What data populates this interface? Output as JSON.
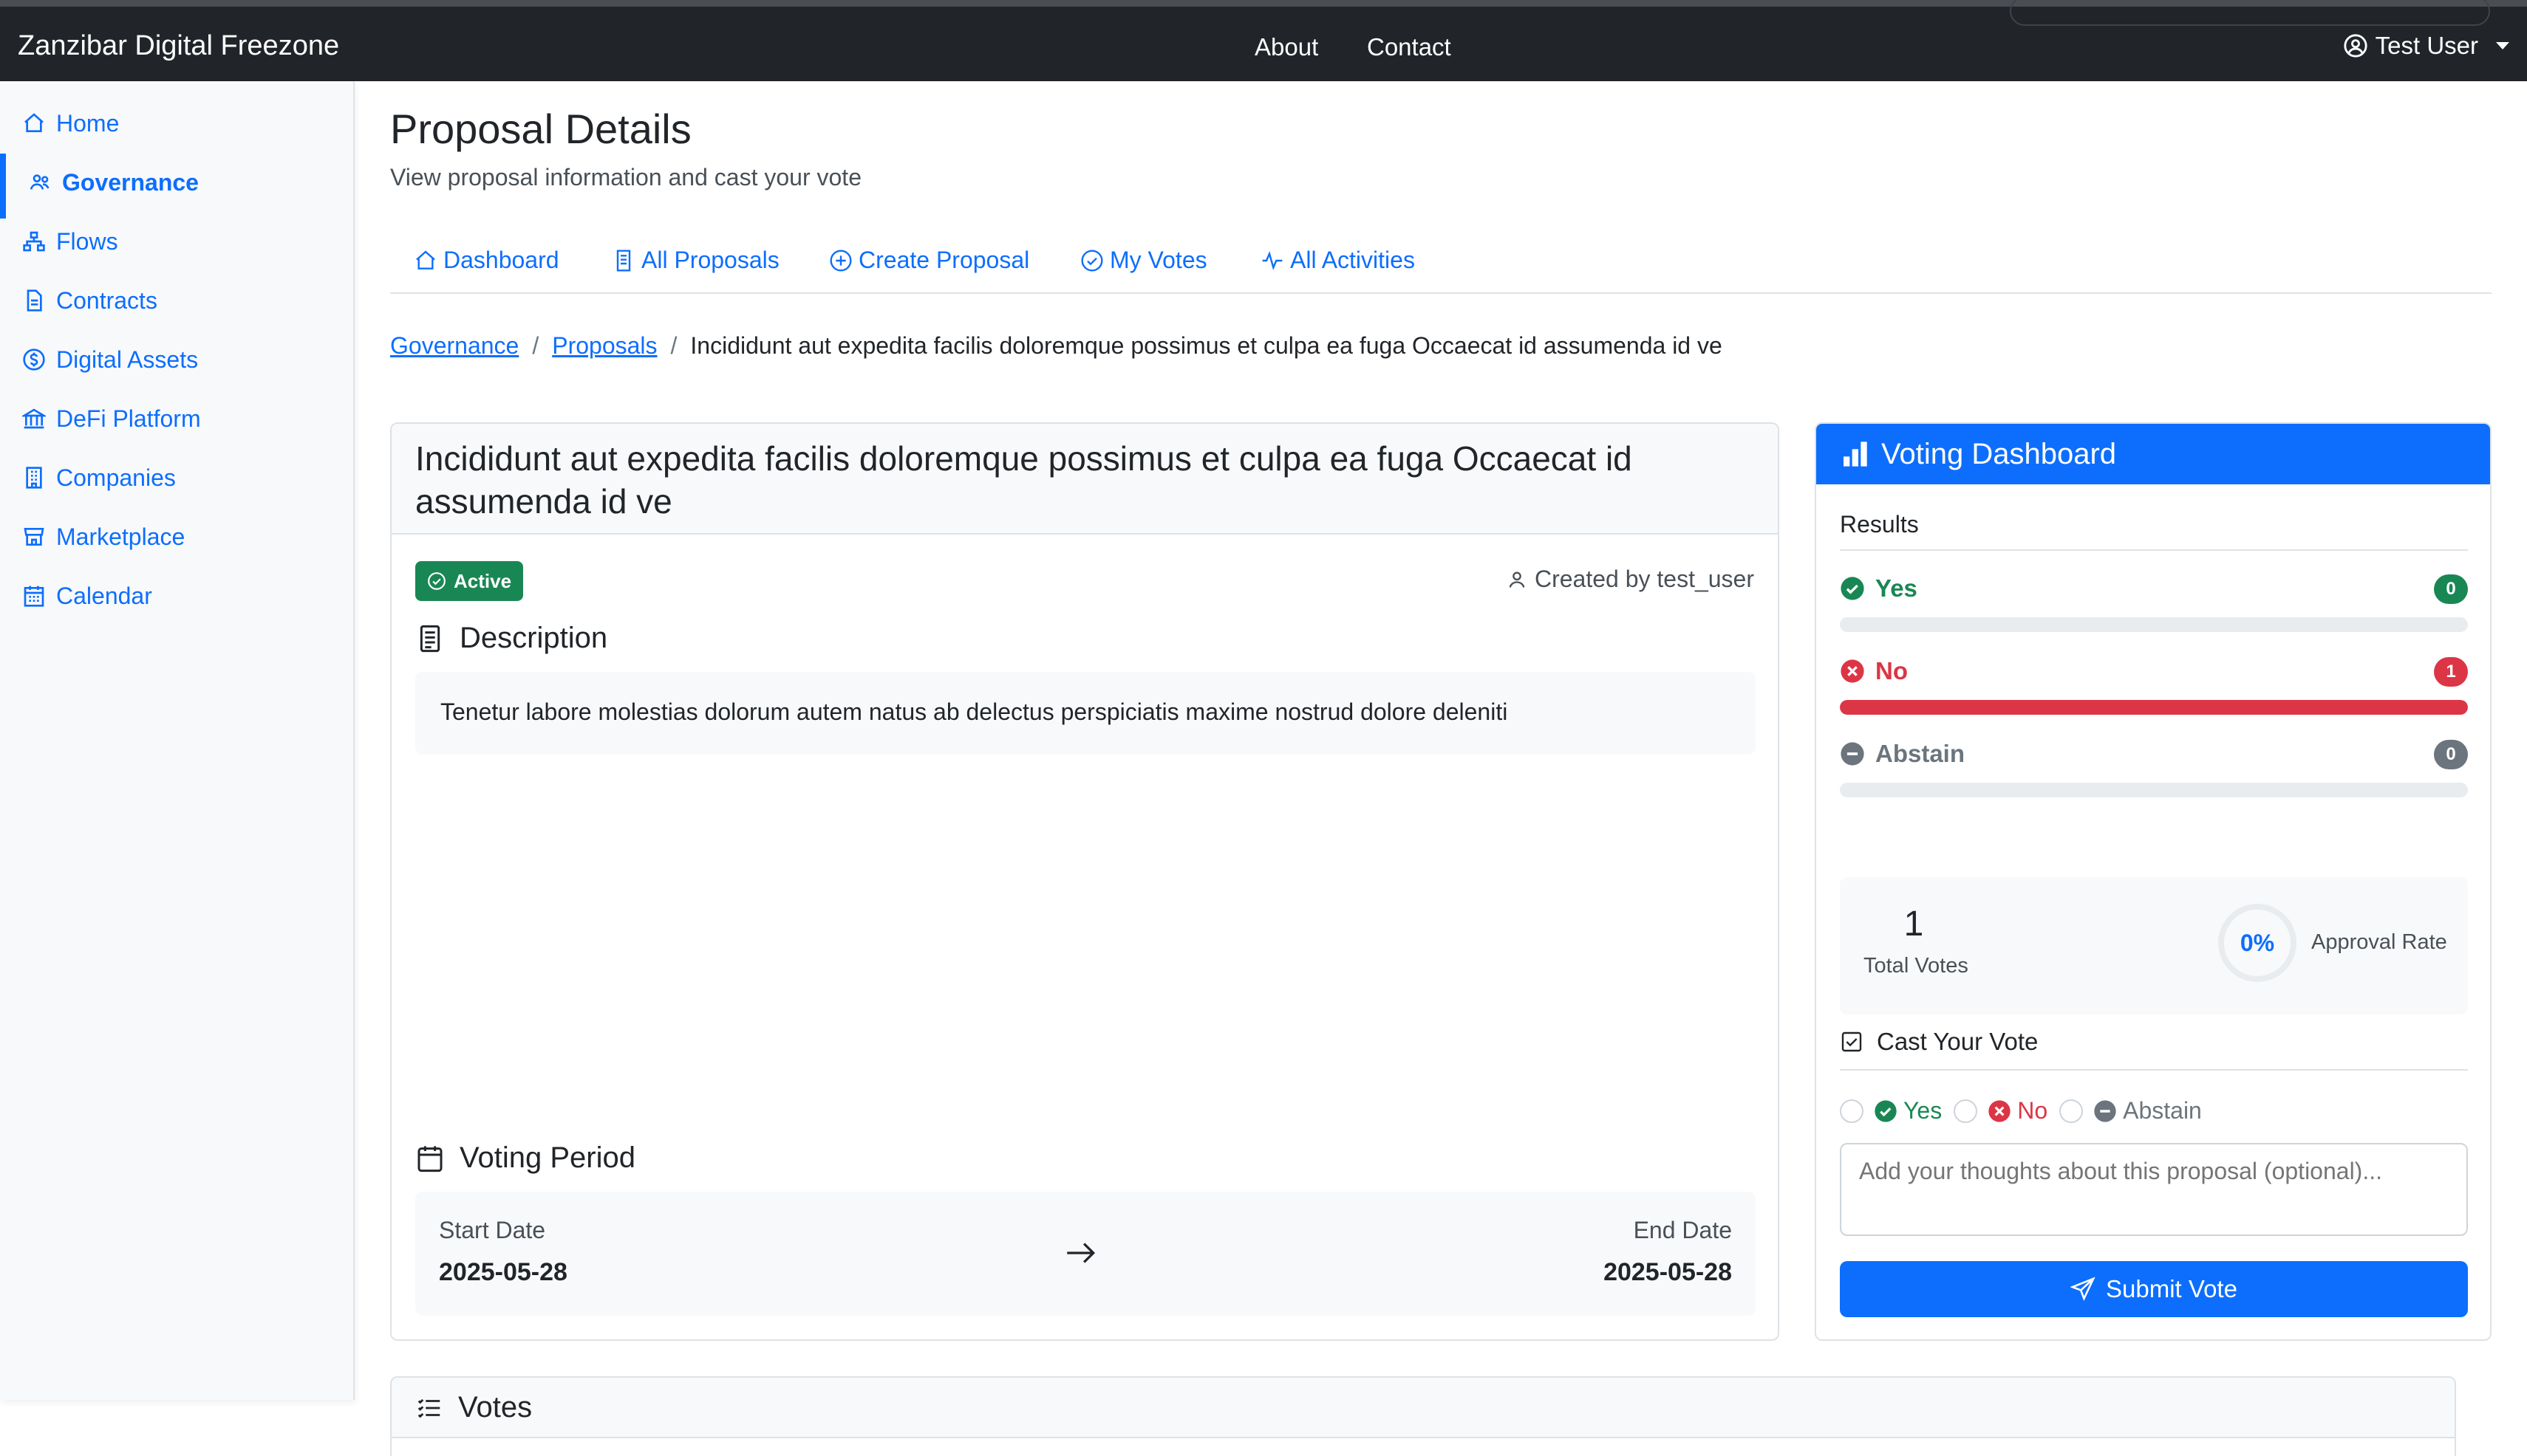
{
  "app": {
    "brand": "Zanzibar Digital Freezone",
    "nav": {
      "about": "About",
      "contact": "Contact"
    },
    "user": "Test User"
  },
  "sidebar": {
    "items": [
      {
        "label": "Home",
        "icon": "home-icon"
      },
      {
        "label": "Governance",
        "icon": "people-icon",
        "active": true
      },
      {
        "label": "Flows",
        "icon": "flows-icon"
      },
      {
        "label": "Contracts",
        "icon": "document-icon"
      },
      {
        "label": "Digital Assets",
        "icon": "coin-icon"
      },
      {
        "label": "DeFi Platform",
        "icon": "bank-icon"
      },
      {
        "label": "Companies",
        "icon": "building-icon"
      },
      {
        "label": "Marketplace",
        "icon": "shop-icon"
      },
      {
        "label": "Calendar",
        "icon": "calendar-icon"
      }
    ]
  },
  "page": {
    "title": "Proposal Details",
    "subtitle": "View proposal information and cast your vote"
  },
  "tabs": [
    {
      "label": "Dashboard",
      "icon": "house-icon"
    },
    {
      "label": "All Proposals",
      "icon": "file-icon"
    },
    {
      "label": "Create Proposal",
      "icon": "plus-circle-icon"
    },
    {
      "label": "My Votes",
      "icon": "check-circle-icon"
    },
    {
      "label": "All Activities",
      "icon": "activity-icon"
    }
  ],
  "breadcrumb": {
    "governance": "Governance",
    "proposals": "Proposals",
    "current": "Incididunt aut expedita facilis doloremque possimus et culpa ea fuga Occaecat id assumenda id ve",
    "separator": "/"
  },
  "proposal": {
    "title": "Incididunt aut expedita facilis doloremque possimus et culpa ea fuga Occaecat id assumenda id ve",
    "status": "Active",
    "created_by": "Created by test_user",
    "description_heading": "Description",
    "description": "Tenetur labore molestias dolorum autem natus ab delectus perspiciatis maxime nostrud dolore deleniti",
    "voting_period_heading": "Voting Period",
    "start_label": "Start Date",
    "start_date": "2025-05-28",
    "end_label": "End Date",
    "end_date": "2025-05-28"
  },
  "voting": {
    "header": "Voting Dashboard",
    "results_label": "Results",
    "options": [
      {
        "label": "Yes",
        "count": "0",
        "share": 0,
        "color": "#198754"
      },
      {
        "label": "No",
        "count": "1",
        "share": 1.0,
        "color": "#dc3545"
      },
      {
        "label": "Abstain",
        "count": "0",
        "share": 0,
        "color": "#6c757d"
      }
    ],
    "total_votes": "1",
    "total_votes_label": "Total Votes",
    "approval_rate": "0%",
    "approval_label": "Approval Rate",
    "cast_heading": "Cast Your Vote",
    "radio_yes": "Yes",
    "radio_no": "No",
    "radio_abstain": "Abstain",
    "comment_placeholder": "Add your thoughts about this proposal (optional)...",
    "submit_label": "Submit Vote"
  },
  "votes_section": {
    "title": "Votes"
  },
  "colors": {
    "primary": "#0d6efd",
    "success": "#198754",
    "danger": "#dc3545",
    "secondary": "#6c757d",
    "navbar": "#212529"
  }
}
